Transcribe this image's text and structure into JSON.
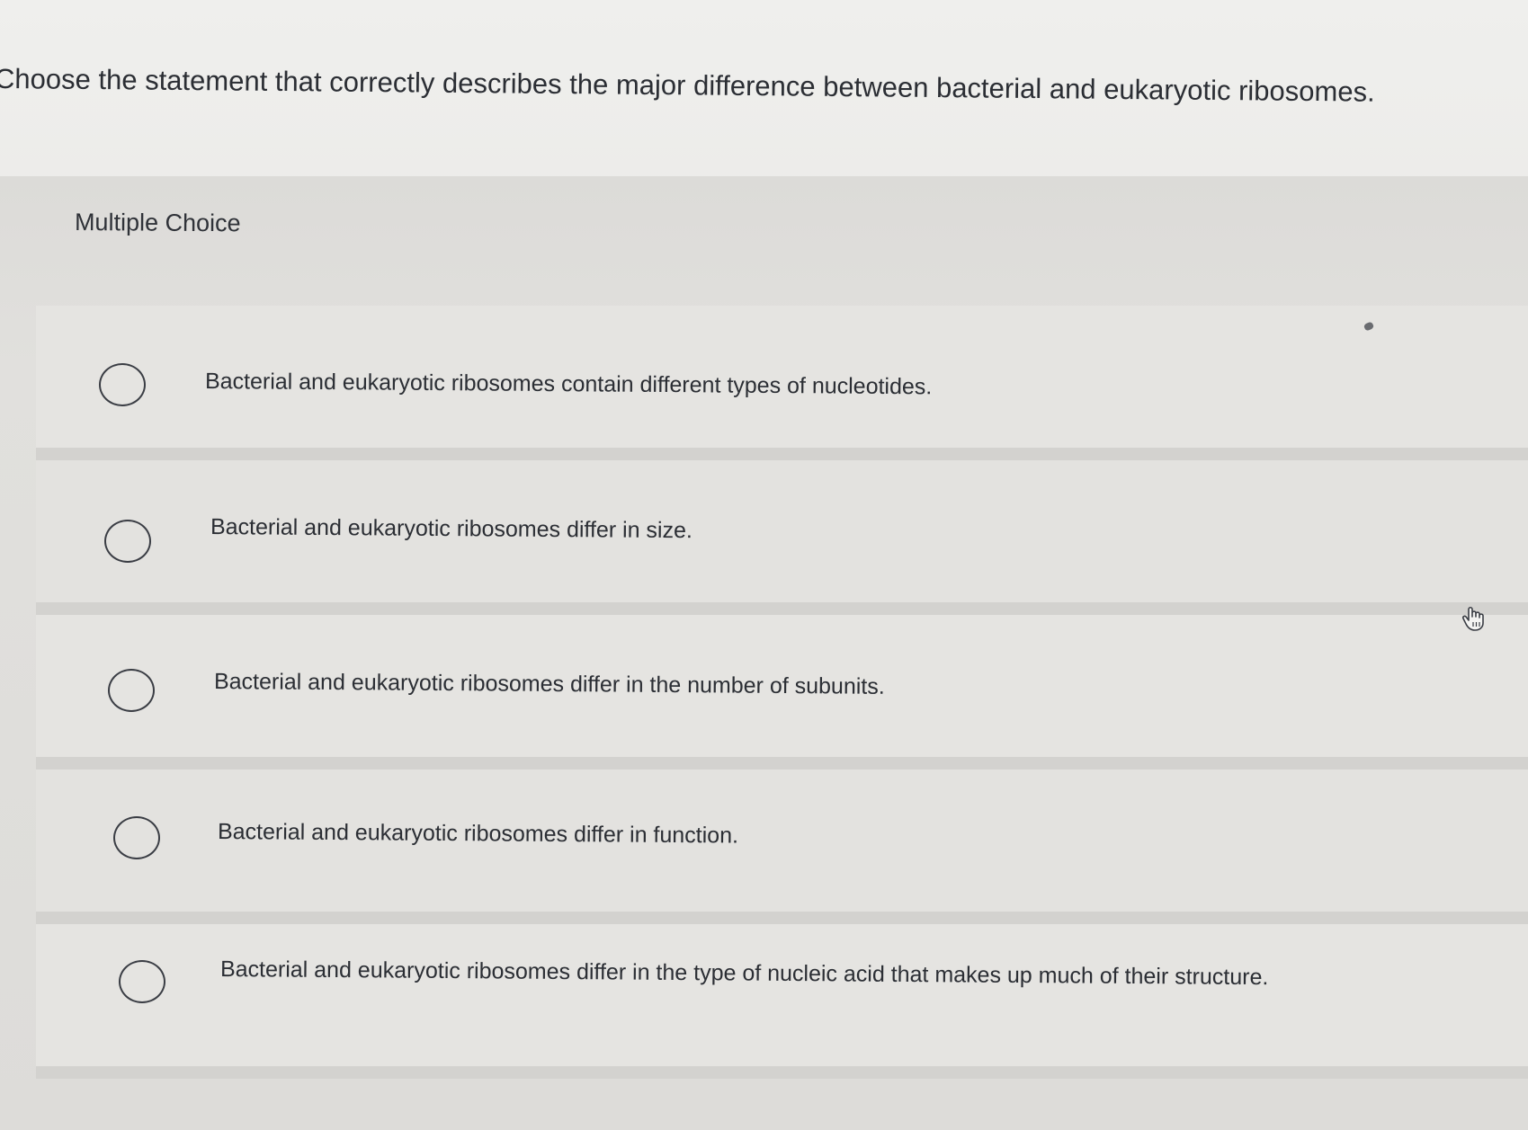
{
  "question": {
    "text": "Choose the statement that correctly describes the major difference between bacterial and eukaryotic ribosomes."
  },
  "question_type": {
    "label": "Multiple Choice"
  },
  "options": [
    {
      "label": "Bacterial and eukaryotic ribosomes contain different types of nucleotides.",
      "selected": false
    },
    {
      "label": "Bacterial and eukaryotic ribosomes differ in size.",
      "selected": false
    },
    {
      "label": "Bacterial and eukaryotic ribosomes differ in the number of subunits.",
      "selected": false
    },
    {
      "label": "Bacterial and eukaryotic ribosomes differ in function.",
      "selected": false
    },
    {
      "label": "Bacterial and eukaryotic ribosomes differ in the type of nucleic acid that makes up much of their structure.",
      "selected": false
    }
  ],
  "cursor": {
    "icon": "hand-pointer-icon"
  },
  "colors": {
    "text": "#2b2e34",
    "background": "#e9e8e5",
    "radio_border": "#3a3d44"
  }
}
